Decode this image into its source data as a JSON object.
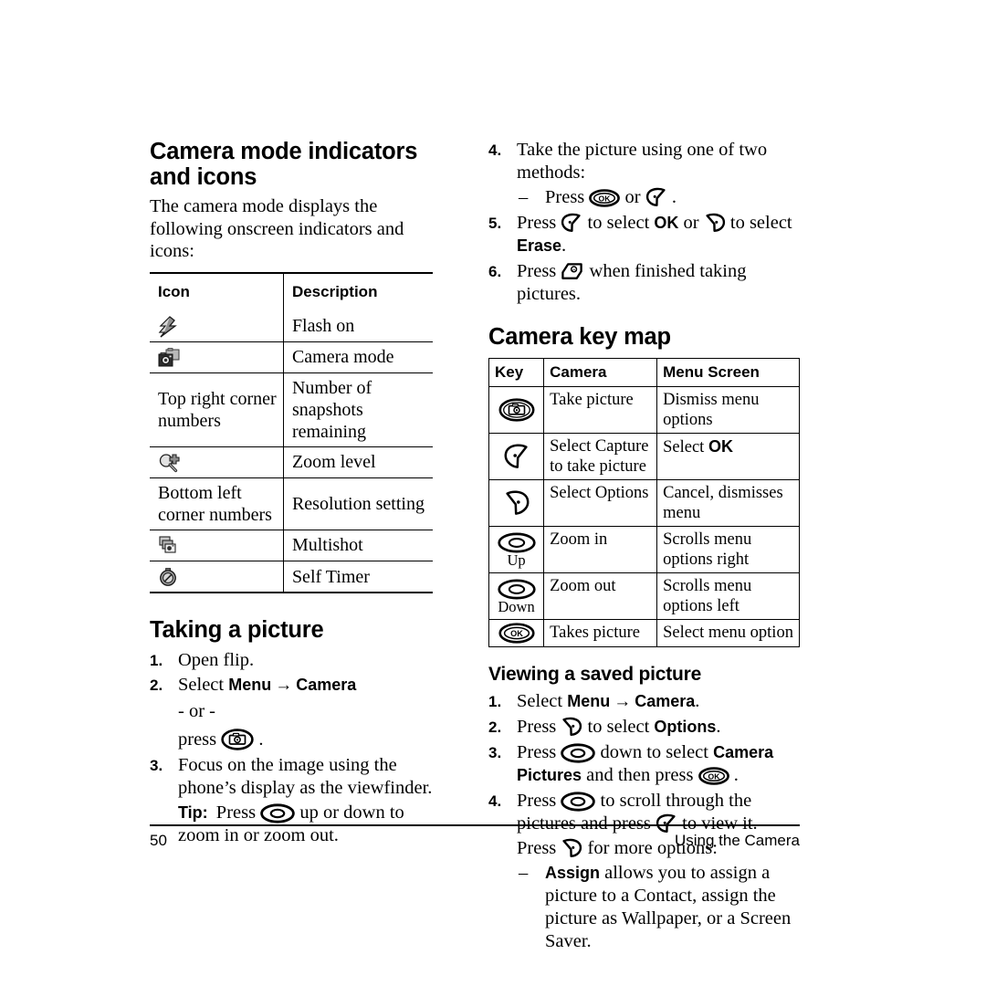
{
  "page": {
    "number": "50",
    "running_head": "Using the Camera"
  },
  "left_column": {
    "heading": "Camera mode indicators and icons",
    "heading_line1": "Camera mode indicators",
    "heading_line2": "and icons",
    "intro": "The camera mode displays the following onscreen indicators and icons:",
    "icon_table": {
      "headers": [
        "Icon",
        "Description"
      ],
      "rows": [
        {
          "icon": "flash-on-icon",
          "icon_text": "",
          "description": "Flash on"
        },
        {
          "icon": "camera-mode-icon",
          "icon_text": "",
          "description": "Camera mode"
        },
        {
          "icon": "",
          "icon_text": "Top right corner numbers",
          "description": "Number of snapshots remaining"
        },
        {
          "icon": "zoom-level-icon",
          "icon_text": "",
          "description": "Zoom level"
        },
        {
          "icon": "",
          "icon_text": "Bottom left corner numbers",
          "description": "Resolution setting"
        },
        {
          "icon": "multishot-icon",
          "icon_text": "",
          "description": "Multishot"
        },
        {
          "icon": "self-timer-icon",
          "icon_text": "",
          "description": "Self Timer"
        }
      ]
    },
    "taking_a_picture": {
      "heading": "Taking a picture",
      "step1_num": "1.",
      "step1_text": "Open flip.",
      "step2_num": "2.",
      "step2_pre": "Select ",
      "step2_menu": "Menu",
      "step2_arrow": "→",
      "step2_camera": "Camera",
      "step2_or": "- or -",
      "step2_press": "press",
      "step2_press_after": ".",
      "step3_num": "3.",
      "step3_text": "Focus on the image using the phone’s display as the viewfinder.",
      "tip_label": "Tip:",
      "tip_pre": "Press",
      "tip_post": "up or down to zoom in or zoom out."
    }
  },
  "right_column": {
    "continued_steps": {
      "step4_num": "4.",
      "step4_text": "Take the picture using one of two methods:",
      "step4_dash": "–",
      "step4_sub_pre": "Press",
      "step4_sub_or": "or",
      "step4_sub_end": ".",
      "step5_num": "5.",
      "step5_pre": "Press",
      "step5_mid1": "to select",
      "step5_ok": "OK",
      "step5_or": "or",
      "step5_mid2": "to select",
      "step5_erase": "Erase",
      "step5_end": ".",
      "step6_num": "6.",
      "step6_pre": "Press",
      "step6_post": "when finished taking pictures."
    },
    "key_map": {
      "heading": "Camera key map",
      "headers": [
        "Key",
        "Camera",
        "Menu Screen"
      ],
      "rows": [
        {
          "key_icon": "camera-key-icon",
          "key_label": "",
          "camera": "Take picture",
          "menu_screen": "Dismiss menu options"
        },
        {
          "key_icon": "left-softkey-icon",
          "key_label": "",
          "camera": "Select Capture to take picture",
          "menu_screen_pre": "Select ",
          "menu_screen_bold": "OK",
          "menu_screen": "Select OK"
        },
        {
          "key_icon": "right-softkey-icon",
          "key_label": "",
          "camera": "Select Options",
          "menu_screen": "Cancel, dismisses menu"
        },
        {
          "key_icon": "nav-key-icon",
          "key_label": "Up",
          "camera": "Zoom in",
          "menu_screen": "Scrolls menu options right"
        },
        {
          "key_icon": "nav-key-icon",
          "key_label": "Down",
          "camera": "Zoom out",
          "menu_screen": "Scrolls menu options left"
        },
        {
          "key_icon": "ok-key-icon",
          "key_label": "",
          "camera": "Takes picture",
          "menu_screen": "Select menu option"
        }
      ]
    },
    "viewing": {
      "heading": "Viewing a saved picture",
      "step1_num": "1.",
      "step1_pre": "Select ",
      "step1_menu": "Menu",
      "step1_arrow": "→",
      "step1_camera": "Camera",
      "step1_end": ".",
      "step2_num": "2.",
      "step2_pre": "Press",
      "step2_mid": "to select",
      "step2_options": "Options",
      "step2_end": ".",
      "step3_num": "3.",
      "step3_pre": "Press",
      "step3_mid": "down to select",
      "step3_bold": "Camera Pictures",
      "step3_cont": "and then press",
      "step3_end": ".",
      "step4_num": "4.",
      "step4_pre": "Press",
      "step4_mid": "to scroll through the pictures and press",
      "step4_post": "to view it.",
      "step4_line3_pre": "Press",
      "step4_line3_post": "for more options:",
      "bullet_dash": "–",
      "bullet_bold": "Assign",
      "bullet_text": " allows you to assign a picture to a Contact, assign the picture as Wallpaper, or a Screen Saver."
    }
  },
  "colors": {
    "ink": "#000000",
    "paper": "#ffffff",
    "icon_gray_light": "#d9d9d9",
    "icon_gray_mid": "#9a9a9a",
    "icon_gray_dark": "#4a4a4a"
  }
}
